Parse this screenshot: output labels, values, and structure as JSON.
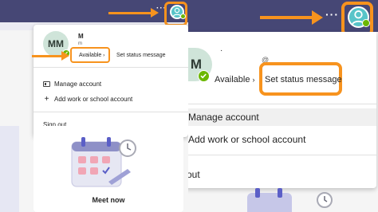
{
  "colors": {
    "accent": "#f7931e",
    "titlebar": "#464775",
    "avatar": "#58c4c9",
    "presence": "#6bb700"
  },
  "left": {
    "more_options": "···",
    "profile": {
      "initials": "MM",
      "name": "M",
      "subtitle": "m",
      "status": "Available",
      "status_chevron": "›",
      "set_status": "Set status message"
    },
    "menu": {
      "manage_account": "Manage account",
      "add_account": "Add work or school account",
      "sign_out": "Sign out"
    },
    "card_label": "Meet now"
  },
  "right": {
    "more_options": "···",
    "profile": {
      "initial": "M",
      "name_fragment": "·",
      "email_fragment": "@",
      "status": "Available",
      "status_chevron": "›",
      "set_status": "Set status message"
    },
    "menu": {
      "manage_account": "Manage account",
      "add_account": "Add work or school account",
      "sign_out": "n out"
    }
  },
  "icons": [
    "person-icon",
    "presence-available-icon",
    "id-card-icon",
    "plus-icon",
    "calendar-icon",
    "alarm-clock-icon",
    "pen-icon",
    "arrow-icon"
  ]
}
